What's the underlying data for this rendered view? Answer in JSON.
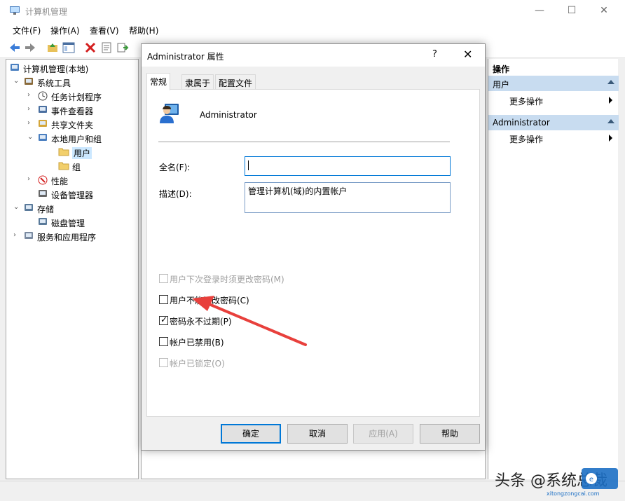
{
  "window": {
    "title": "计算机管理"
  },
  "menu": [
    "文件(F)",
    "操作(A)",
    "查看(V)",
    "帮助(H)"
  ],
  "tree": [
    {
      "label": "计算机管理(本地)",
      "level": 0,
      "arrow": "",
      "icon": "computer-management-icon"
    },
    {
      "label": "系统工具",
      "level": 1,
      "arrow": "expanded",
      "icon": "tools-icon"
    },
    {
      "label": "任务计划程序",
      "level": 2,
      "arrow": "collapsed",
      "icon": "clock-icon"
    },
    {
      "label": "事件查看器",
      "level": 2,
      "arrow": "collapsed",
      "icon": "event-viewer-icon"
    },
    {
      "label": "共享文件夹",
      "level": 2,
      "arrow": "collapsed",
      "icon": "shared-folder-icon"
    },
    {
      "label": "本地用户和组",
      "level": 2,
      "arrow": "expanded",
      "icon": "users-groups-icon"
    },
    {
      "label": "用户",
      "level": 3,
      "arrow": "",
      "icon": "folder-icon",
      "selected": true
    },
    {
      "label": "组",
      "level": 3,
      "arrow": "",
      "icon": "folder-icon"
    },
    {
      "label": "性能",
      "level": 2,
      "arrow": "collapsed",
      "icon": "performance-icon"
    },
    {
      "label": "设备管理器",
      "level": 2,
      "arrow": "",
      "icon": "device-manager-icon"
    },
    {
      "label": "存储",
      "level": 1,
      "arrow": "expanded",
      "icon": "storage-icon"
    },
    {
      "label": "磁盘管理",
      "level": 2,
      "arrow": "",
      "icon": "disk-icon"
    },
    {
      "label": "服务和应用程序",
      "level": 1,
      "arrow": "collapsed",
      "icon": "services-icon"
    }
  ],
  "actions": {
    "header": "操作",
    "sections": [
      {
        "title": "用户",
        "item": "更多操作"
      },
      {
        "title": "Administrator",
        "item": "更多操作"
      }
    ]
  },
  "dialog": {
    "title": "Administrator 属性",
    "help_glyph": "?",
    "close_glyph": "✕",
    "tabs": [
      "常规",
      "隶属于",
      "配置文件"
    ],
    "user_name": "Administrator",
    "fullname_label": "全名(F):",
    "fullname_value": "",
    "description_label": "描述(D):",
    "description_value": "管理计算机(域)的内置帐户",
    "checkboxes": [
      {
        "label": "用户下次登录时须更改密码(M)",
        "checked": false,
        "disabled": true
      },
      {
        "label": "用户不能更改密码(C)",
        "checked": false,
        "disabled": false
      },
      {
        "label": "密码永不过期(P)",
        "checked": true,
        "disabled": false
      },
      {
        "label": "帐户已禁用(B)",
        "checked": false,
        "disabled": false
      },
      {
        "label": "帐户已锁定(O)",
        "checked": false,
        "disabled": true
      }
    ],
    "buttons": {
      "ok": "确定",
      "cancel": "取消",
      "apply": "应用(A)",
      "help": "帮助"
    }
  },
  "watermark": {
    "text": "头条 @系统总裁",
    "site": "xitongzongcai.com"
  },
  "colors": {
    "accent": "#0078d7",
    "arrow": "#e8403c",
    "selection": "#cce8ff",
    "section": "#c8dcf0"
  }
}
